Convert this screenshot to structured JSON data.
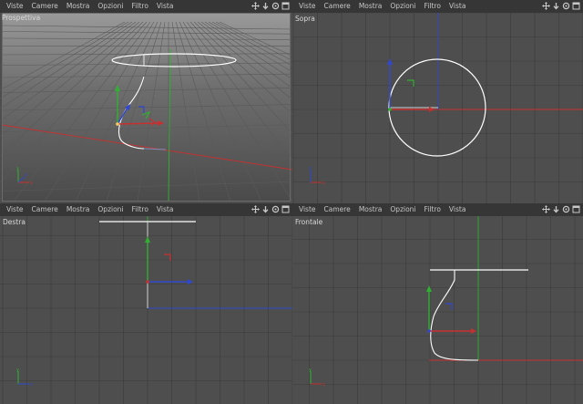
{
  "menu": [
    "Viste",
    "Camere",
    "Mostra",
    "Opzioni",
    "Filtro",
    "Vista"
  ],
  "icons": [
    "move-icon",
    "zoom-icon",
    "rotate-icon",
    "maximize-icon"
  ],
  "viewports": {
    "perspective": {
      "label": "Prospettiva"
    },
    "top": {
      "label": "Sopra"
    },
    "right": {
      "label": "Destra"
    },
    "front": {
      "label": "Frontale"
    }
  },
  "colors": {
    "background": "#4e4e4e",
    "grid": "#3c3c3c",
    "axis_x": "#c83030",
    "axis_y": "#30b030",
    "axis_z": "#3048d0",
    "spline": "#ffffff",
    "menubar": "#363636"
  }
}
